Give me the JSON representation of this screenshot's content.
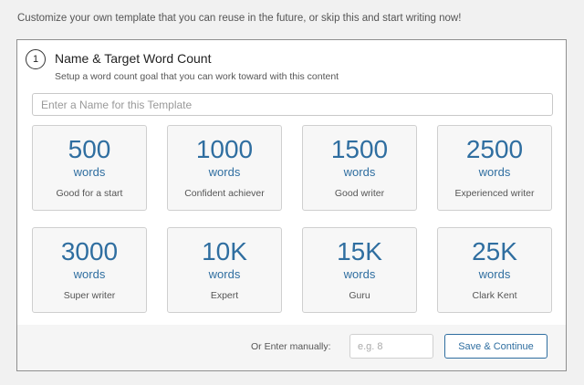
{
  "intro_text": "Customize your own template that you can reuse in the future, or skip this and start writing now!",
  "step": {
    "number": "1",
    "title": "Name & Target Word Count",
    "subtitle": "Setup a word count goal that you can work toward with this content"
  },
  "name_field": {
    "placeholder": "Enter a Name for this Template",
    "value": ""
  },
  "cards": [
    {
      "number": "500",
      "unit": "words",
      "label": "Good for a start"
    },
    {
      "number": "1000",
      "unit": "words",
      "label": "Confident achiever"
    },
    {
      "number": "1500",
      "unit": "words",
      "label": "Good writer"
    },
    {
      "number": "2500",
      "unit": "words",
      "label": "Experienced writer"
    },
    {
      "number": "3000",
      "unit": "words",
      "label": "Super writer"
    },
    {
      "number": "10K",
      "unit": "words",
      "label": "Expert"
    },
    {
      "number": "15K",
      "unit": "words",
      "label": "Guru"
    },
    {
      "number": "25K",
      "unit": "words",
      "label": "Clark Kent"
    }
  ],
  "footer": {
    "manual_label": "Or Enter manually:",
    "manual_placeholder": "e.g. 8",
    "save_label": "Save & Continue"
  },
  "colors": {
    "accent": "#2f6ea0",
    "background": "#f1f1f1",
    "card_background": "#f7f7f7"
  }
}
